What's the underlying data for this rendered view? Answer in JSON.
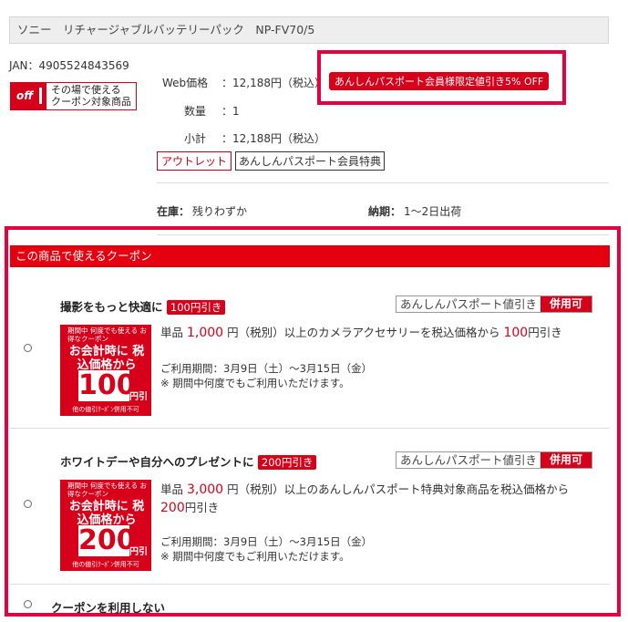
{
  "product": {
    "title": "ソニー　リチャージャブルバッテリーパック　NP-FV70/5",
    "jan": "JAN：4905524843569",
    "off_icon": "off",
    "off_text_1": "その場で使える",
    "off_text_2": "クーポン対象商品"
  },
  "pricing": {
    "web_price_label": "Web価格",
    "web_price_value": "：12,188円（税込）",
    "qty_label": "数量",
    "qty_value": "：1",
    "subtotal_label": "小計",
    "subtotal_value": "：12,188円（税込）",
    "member_discount": "あんしんパスポート会員様限定値引き5% OFF",
    "tag_outlet": "アウトレット",
    "tag_member": "あんしんパスポート会員特典"
  },
  "stock": {
    "stock_label": "在庫：",
    "stock_value": "残りわずか",
    "delivery_label": "納期：",
    "delivery_value": "1〜2日出荷"
  },
  "coupon_section": {
    "header": "この商品で使えるクーポン",
    "no_coupon_label": "クーポンを利用しない",
    "coupons": [
      {
        "title": "撮影をもっと快適に",
        "tag": "100円引き",
        "pass_label": "あんしんパスポート値引き",
        "combinable": "併用可",
        "img_top": "期間中 何度でも使える お得なクーポン",
        "img_mid": "お会計時に 税込価格から",
        "img_amount": "100",
        "img_unit": "円引",
        "img_bottom": "他の値引ｸｰﾎﾟﾝ併用不可",
        "desc_1": "単品",
        "desc_amount": "1,000",
        "desc_2": "円（税別）以上のカメラアクセサリーを税込価格から",
        "desc_discount": "100",
        "desc_3": "円引き",
        "period": "ご利用期間：3月9日（土）〜3月15日（金）",
        "note": "※ 期間中何度でもご利用いただけます。"
      },
      {
        "title": "ホワイトデーや自分へのプレゼントに",
        "tag": "200円引き",
        "pass_label": "あんしんパスポート値引き",
        "combinable": "併用可",
        "img_top": "期間中 何度でも使える お得なクーポン",
        "img_mid": "お会計時に 税込価格から",
        "img_amount": "200",
        "img_unit": "円引",
        "img_bottom": "他の値引ｸｰﾎﾟﾝ併用不可",
        "desc_1": "単品",
        "desc_amount": "3,000",
        "desc_2": "円（税別）以上のあんしんパスポート特典対象商品を税込価格から",
        "desc_discount": "200",
        "desc_3": "円引き",
        "period": "ご利用期間：3月9日（土）〜3月15日（金）",
        "note": "※ 期間中何度でもご利用いただけます。"
      }
    ]
  }
}
